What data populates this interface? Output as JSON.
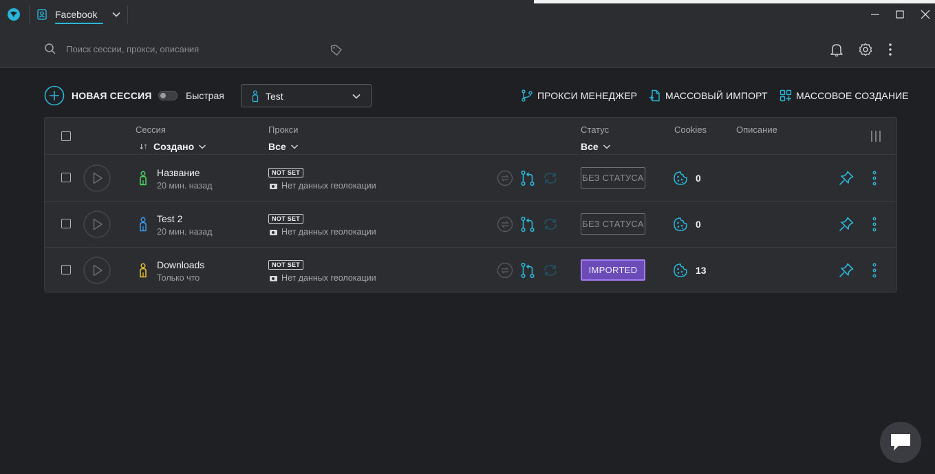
{
  "titlebar": {
    "tab_label": "Facebook"
  },
  "search": {
    "placeholder": "Поиск сессии, прокси, описания"
  },
  "toolbar": {
    "new_session_label": "НОВАЯ СЕССИЯ",
    "quick_toggle_label": "Быстрая",
    "quick_toggle_on": false,
    "profile_select_value": "Test",
    "proxy_manager_label": "ПРОКСИ МЕНЕДЖЕР",
    "bulk_import_label": "МАССОВЫЙ ИМПОРТ",
    "bulk_create_label": "МАССОВОЕ СОЗДАНИЕ"
  },
  "table": {
    "headers": {
      "session": "Сессия",
      "session_sort": "Создано",
      "proxy": "Прокси",
      "proxy_filter": "Все",
      "status": "Статус",
      "status_filter": "Все",
      "cookies": "Cookies",
      "description": "Описание"
    },
    "rows": [
      {
        "name": "Название",
        "time": "20 мин. назад",
        "person_color": "#4cd964",
        "proxy": "NOT SET",
        "geo": "Нет данных геолокации",
        "status": "БЕЗ СТАТУСА",
        "status_kind": "none",
        "cookies": "0"
      },
      {
        "name": "Test 2",
        "time": "20 мин. назад",
        "person_color": "#3b9cf2",
        "proxy": "NOT SET",
        "geo": "Нет данных геолокации",
        "status": "БЕЗ СТАТУСА",
        "status_kind": "none",
        "cookies": "0"
      },
      {
        "name": "Downloads",
        "time": "Только что",
        "person_color": "#f2c230",
        "proxy": "NOT SET",
        "geo": "Нет данных геолокации",
        "status": "IMPORTED",
        "status_kind": "imported",
        "cookies": "13"
      }
    ]
  },
  "colors": {
    "accent": "#29b6d8",
    "background": "#1f2023",
    "panel": "#2b2d31",
    "imported": "#6a4bb8"
  }
}
